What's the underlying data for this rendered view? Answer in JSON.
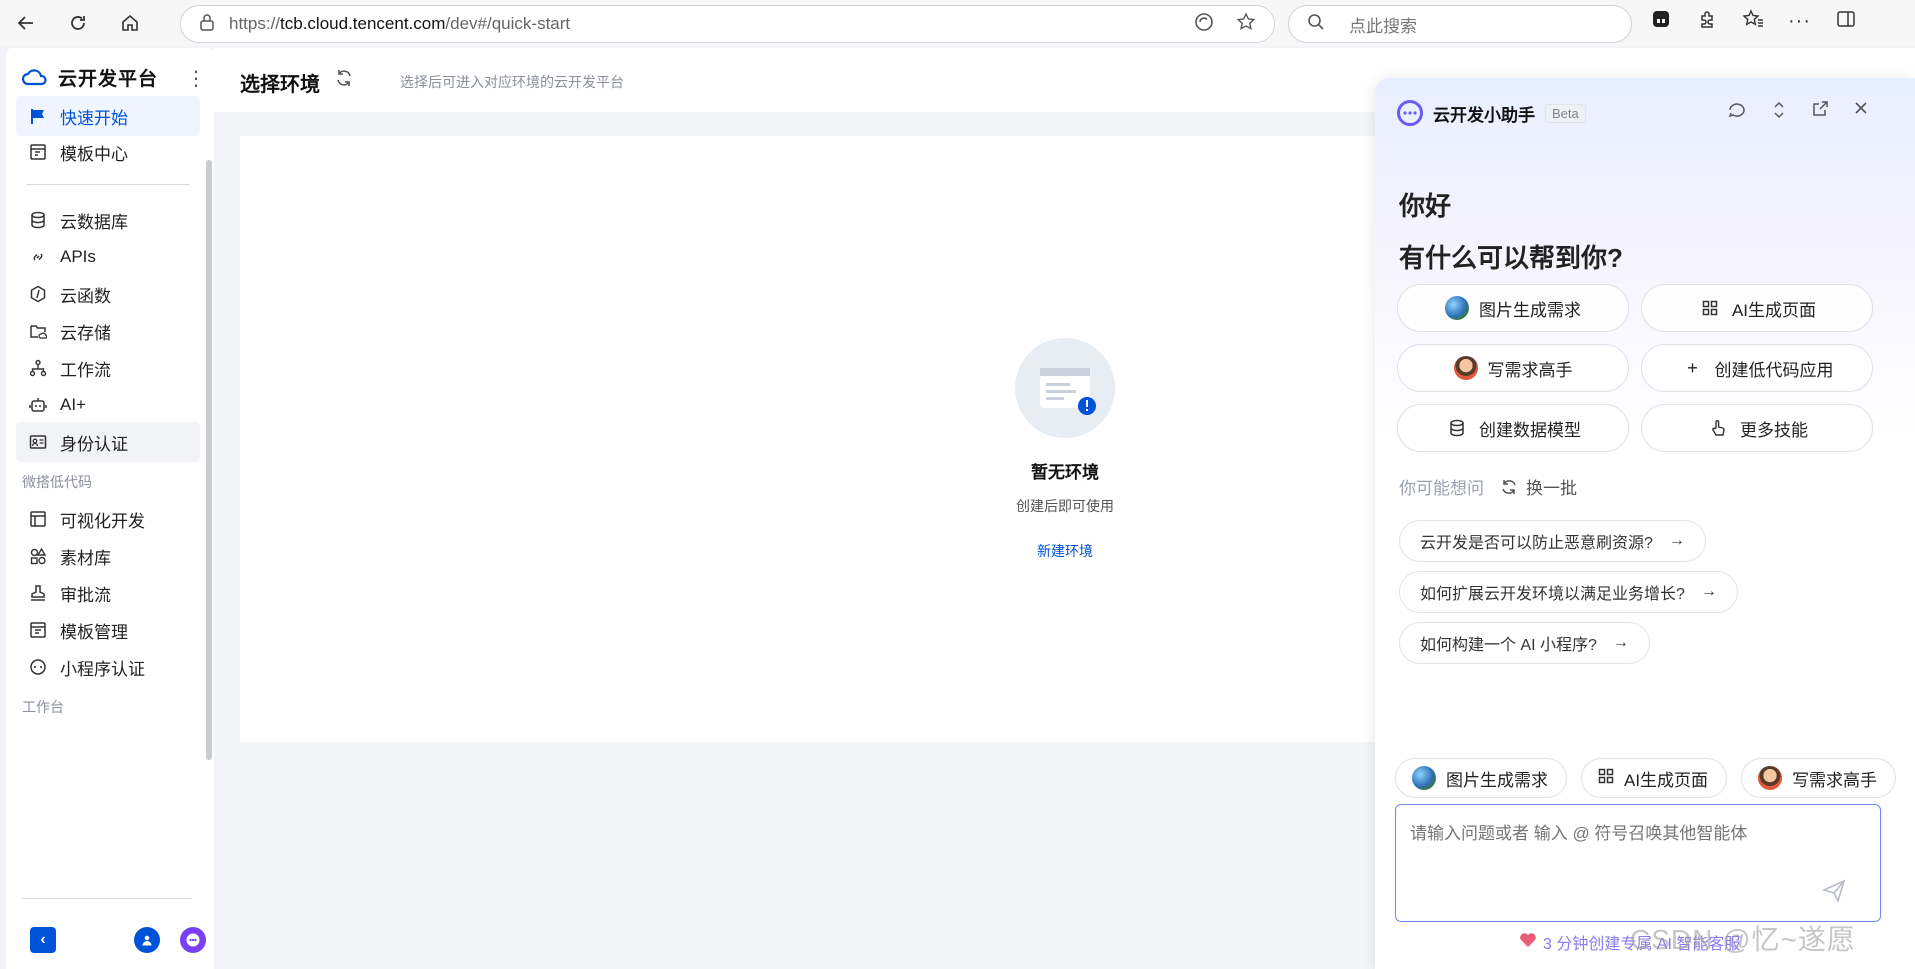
{
  "browser": {
    "url_prefix": "https://",
    "url_host": "tcb.cloud.tencent.com",
    "url_path": "/dev#/quick-start",
    "search_placeholder": "点此搜索"
  },
  "sidebar": {
    "brand": "云开发平台",
    "items_top": [
      {
        "label": "快速开始",
        "icon": "flag-icon",
        "active": true
      },
      {
        "label": "模板中心",
        "icon": "template-icon"
      }
    ],
    "items_main": [
      {
        "label": "云数据库",
        "icon": "database-icon"
      },
      {
        "label": "APIs",
        "icon": "link-icon"
      },
      {
        "label": "云函数",
        "icon": "function-icon"
      },
      {
        "label": "云存储",
        "icon": "folder-cloud-icon"
      },
      {
        "label": "工作流",
        "icon": "workflow-icon"
      },
      {
        "label": "AI+",
        "icon": "robot-icon"
      },
      {
        "label": "身份认证",
        "icon": "id-card-icon"
      }
    ],
    "group_lowcode": "微搭低代码",
    "items_lowcode": [
      {
        "label": "可视化开发",
        "icon": "layout-icon"
      },
      {
        "label": "素材库",
        "icon": "shapes-icon"
      },
      {
        "label": "审批流",
        "icon": "stamp-icon"
      },
      {
        "label": "模板管理",
        "icon": "template-manage-icon"
      },
      {
        "label": "小程序认证",
        "icon": "miniprogram-icon"
      }
    ],
    "group_workbench": "工作台"
  },
  "header": {
    "title": "选择环境",
    "subtitle": "选择后可进入对应环境的云开发平台"
  },
  "empty": {
    "title": "暂无环境",
    "subtitle": "创建后即可使用",
    "action": "新建环境"
  },
  "assistant": {
    "title": "云开发小助手",
    "badge": "Beta",
    "greeting": "你好",
    "question": "有什么可以帮到你?",
    "skills": [
      {
        "label": "图片生成需求"
      },
      {
        "label": "AI生成页面"
      },
      {
        "label": "写需求高手"
      },
      {
        "label": "创建低代码应用"
      },
      {
        "label": "创建数据模型"
      },
      {
        "label": "更多技能"
      }
    ],
    "maybe_label": "你可能想问",
    "refresh_label": "换一批",
    "suggestions": [
      "云开发是否可以防止恶意刷资源?",
      "如何扩展云开发环境以满足业务增长?",
      "如何构建一个 AI 小程序?"
    ],
    "chips": [
      "图片生成需求",
      "AI生成页面",
      "写需求高手"
    ],
    "input_placeholder": "请输入问题或者 输入 @ 符号召唤其他智能体",
    "promo": "3 分钟创建专属 AI 智能客服"
  },
  "watermark": "CSDN @忆~遂愿",
  "colors": {
    "accent": "#0052d9",
    "assistant": "#6b5cf6"
  }
}
